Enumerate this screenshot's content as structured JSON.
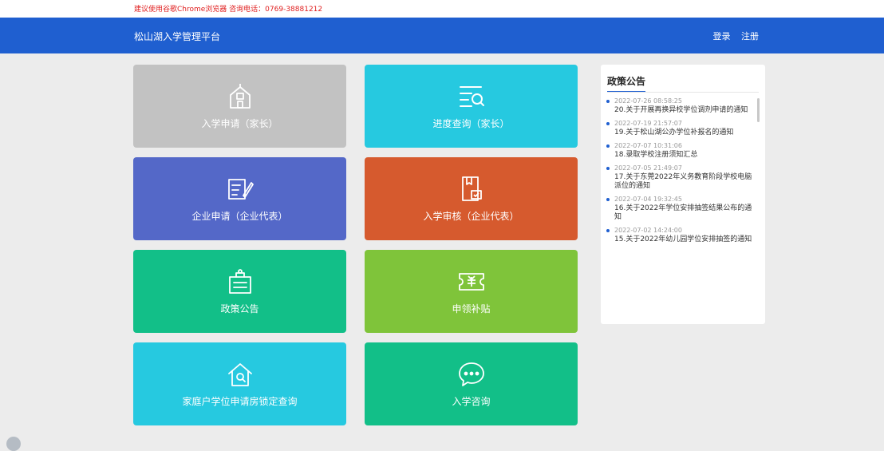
{
  "notice": "建议使用谷歌Chrome浏览器 咨询电话：0769-38881212",
  "header": {
    "title": "松山湖入学管理平台",
    "login_label": "登录",
    "register_label": "注册"
  },
  "tiles": [
    {
      "label": "入学申请（家长）",
      "color": "#c2c2c2",
      "icon": "school-icon"
    },
    {
      "label": "进度查询（家长）",
      "color": "#26c9e0",
      "icon": "list-search-icon"
    },
    {
      "label": "企业申请（企业代表）",
      "color": "#5468c8",
      "icon": "form-edit-icon"
    },
    {
      "label": "入学审核（企业代表）",
      "color": "#d65a2e",
      "icon": "document-check-icon"
    },
    {
      "label": "政策公告",
      "color": "#12bf88",
      "icon": "notice-board-icon"
    },
    {
      "label": "申领补贴",
      "color": "#7fc43a",
      "icon": "voucher-icon"
    },
    {
      "label": "家庭户学位申请房锁定查询",
      "color": "#26c9e0",
      "icon": "house-search-icon"
    },
    {
      "label": "入学咨询",
      "color": "#12bf88",
      "icon": "chat-icon"
    }
  ],
  "side_panel": {
    "title": "政策公告",
    "items": [
      {
        "date": "2022-07-26 08:58:25",
        "title": "20.关于开展再换异校学位调剂申请的通知"
      },
      {
        "date": "2022-07-19 21:57:07",
        "title": "19.关于松山湖公办学位补报名的通知"
      },
      {
        "date": "2022-07-07 10:31:06",
        "title": "18.录取学校注册须知汇总"
      },
      {
        "date": "2022-07-05 21:49:07",
        "title": "17.关于东莞2022年义务教育阶段学校电脑派位的通知"
      },
      {
        "date": "2022-07-04 19:32:45",
        "title": "16.关于2022年学位安排抽签结果公布的通知"
      },
      {
        "date": "2022-07-02 14:24:00",
        "title": "15.关于2022年幼儿园学位安排抽签的通知"
      }
    ]
  }
}
